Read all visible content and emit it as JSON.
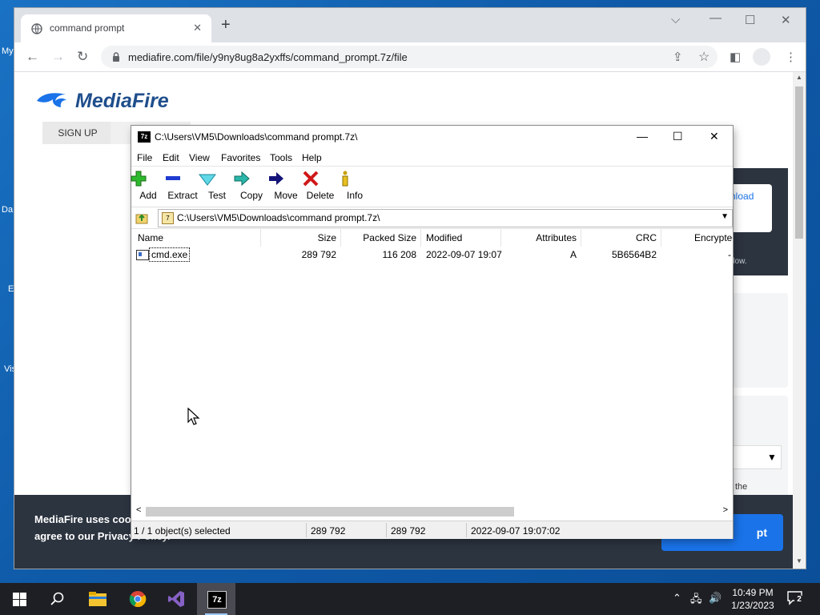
{
  "desktop": {
    "icons": [
      "My",
      "Da",
      "E",
      "Vis"
    ]
  },
  "browser": {
    "tab_title": "command prompt",
    "tab_close": "✕",
    "new_tab": "+",
    "url": "mediafire.com/file/y9ny8ug8a2yxffs/command_prompt.7z/file"
  },
  "page": {
    "logo": "MediaFire",
    "signup": "SIGN UP",
    "download_fragment": "nload",
    "window_fragment": "dow.",
    "the_fragment": "the",
    "cookie_line1": "MediaFire uses cook",
    "cookie_line2": "agree to our Privacy Policy.",
    "accept_fragment": "pt"
  },
  "zip": {
    "title": "C:\\Users\\VM5\\Downloads\\command prompt.7z\\",
    "app_icon": "7z",
    "menu": [
      "File",
      "Edit",
      "View",
      "Favorites",
      "Tools",
      "Help"
    ],
    "tools": [
      {
        "label": "Add",
        "icon": "add-icon"
      },
      {
        "label": "Extract",
        "icon": "extract-icon"
      },
      {
        "label": "Test",
        "icon": "test-icon"
      },
      {
        "label": "Copy",
        "icon": "copy-icon"
      },
      {
        "label": "Move",
        "icon": "move-icon"
      },
      {
        "label": "Delete",
        "icon": "delete-icon"
      },
      {
        "label": "Info",
        "icon": "info-icon"
      }
    ],
    "address": "C:\\Users\\VM5\\Downloads\\command prompt.7z\\",
    "columns": [
      "Name",
      "Size",
      "Packed Size",
      "Modified",
      "Attributes",
      "CRC",
      "Encrypte"
    ],
    "rows": [
      {
        "name": "cmd.exe",
        "size": "289 792",
        "packed": "116 208",
        "modified": "2022-09-07 19:07",
        "attributes": "A",
        "crc": "5B6564B2",
        "encrypted": "-"
      }
    ],
    "status": {
      "selected": "1 / 1 object(s) selected",
      "size": "289 792",
      "packed": "289 792",
      "modified": "2022-09-07 19:07:02"
    }
  },
  "taskbar": {
    "apps": [
      "file-explorer",
      "chrome",
      "visual-studio",
      "7-zip"
    ],
    "time": "10:49 PM",
    "date": "1/23/2023",
    "notification_count": "2"
  }
}
